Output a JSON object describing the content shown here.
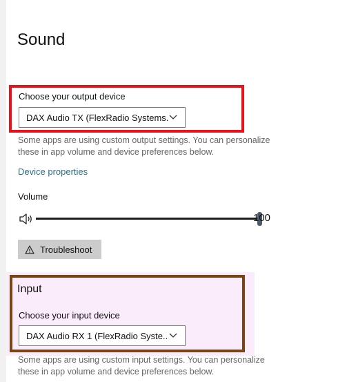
{
  "page": {
    "title": "Sound"
  },
  "output": {
    "label": "Choose your output device",
    "selected_device": "DAX Audio TX (FlexRadio Systems...",
    "description": "Some apps are using custom output settings. You can personalize these in app volume and device preferences below.",
    "device_properties_link": "Device properties"
  },
  "volume": {
    "label": "Volume",
    "value": "100",
    "level_percent": 100,
    "icon": "speaker-icon"
  },
  "troubleshoot": {
    "label": "Troubleshoot",
    "icon": "warning-icon"
  },
  "input": {
    "heading": "Input",
    "label": "Choose your input device",
    "selected_device": "DAX Audio RX 1 (FlexRadio Syste...",
    "description": "Some apps are using custom input settings. You can personalize these in app volume and device preferences below."
  },
  "colors": {
    "output_highlight": "#e8121a",
    "input_highlight": "#7b4414",
    "link": "#2a6f8a"
  }
}
